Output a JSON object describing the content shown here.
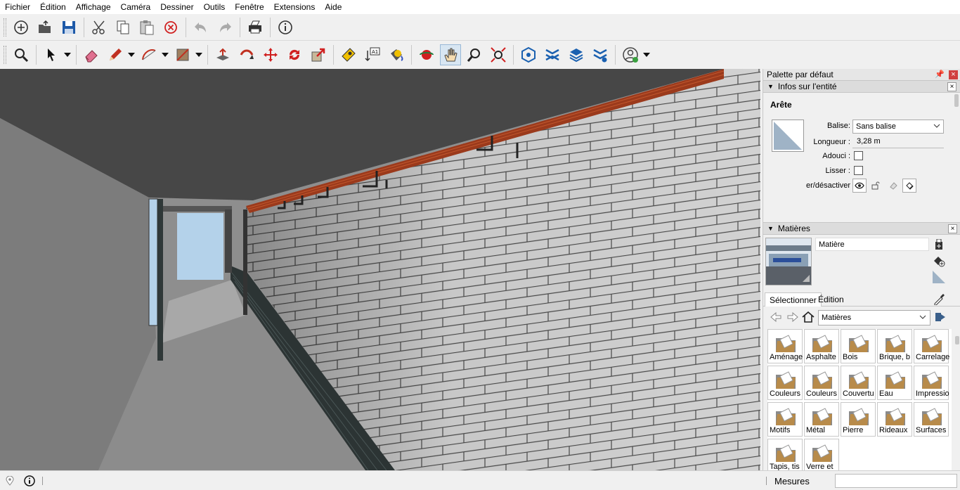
{
  "menu": [
    "Fichier",
    "Édition",
    "Affichage",
    "Caméra",
    "Dessiner",
    "Outils",
    "Fenêtre",
    "Extensions",
    "Aide"
  ],
  "tray": {
    "title": "Palette par défaut",
    "entity_panel": {
      "header": "Infos sur l'entité",
      "entity_type": "Arête",
      "tag_label": "Balise:",
      "tag_value": "Sans balise",
      "length_label": "Longueur :",
      "length_value": "3,28 m",
      "soft_label": "Adouci :",
      "smooth_label": "Lisser :",
      "toggle_label": "er/désactiver"
    },
    "materials_panel": {
      "header": "Matières",
      "material_name": "Matière",
      "tab_select": "Sélectionner",
      "tab_edit": "Édition",
      "category": "Matières",
      "items": [
        "Aménage",
        "Asphalte",
        "Bois",
        "Brique, b",
        "Carrelage",
        "Couleurs",
        "Couleurs",
        "Couvertu",
        "Eau",
        "Impressio",
        "Motifs",
        "Métal",
        "Pierre",
        "Rideaux",
        "Surfaces",
        "Tapis, tis",
        "Verre et"
      ]
    }
  },
  "status": {
    "measures_label": "Mesures",
    "measures_value": ""
  },
  "colors": {
    "wall": "#cfcfcf",
    "ceiling": "#474747",
    "beam": "#9b3a1c",
    "sky": "#b4d2ea",
    "folder": "#b88b4a"
  }
}
